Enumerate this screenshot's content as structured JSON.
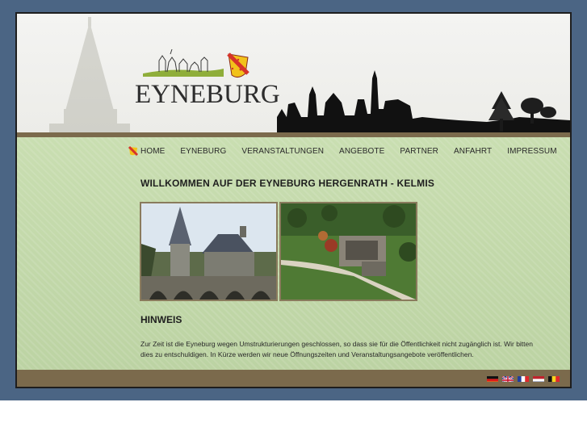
{
  "brand": {
    "name": "EYNEBURG"
  },
  "nav": {
    "items": [
      {
        "label": "HOME"
      },
      {
        "label": "EYNEBURG"
      },
      {
        "label": "VERANSTALTUNGEN"
      },
      {
        "label": "ANGEBOTE"
      },
      {
        "label": "PARTNER"
      },
      {
        "label": "ANFAHRT"
      },
      {
        "label": "IMPRESSUM"
      }
    ]
  },
  "main": {
    "title": "WILLKOMMEN AUF DER EYNEBURG HERGENRATH - KELMIS",
    "subtitle": "HINWEIS",
    "notice_line1": "Zur Zeit ist die Eyneburg wegen Umstrukturierungen geschlossen, so dass sie für die Öffentlichkeit nicht zugänglich ist. Wir bitten",
    "notice_line2": "dies zu entschuldigen. In Kürze werden wir neue Öffnungszeiten und Veranstaltungsangebote veröffentlichen."
  },
  "footer": {
    "languages": [
      "de-flag-icon",
      "uk-flag-icon",
      "fr-flag-icon",
      "nl-flag-icon",
      "be-flag-icon"
    ]
  },
  "colors": {
    "frame": "#4b6584",
    "strip": "#7b6a4c",
    "content": "#c9deb1",
    "shield_red": "#d6332a",
    "shield_yellow": "#f2c21b"
  }
}
